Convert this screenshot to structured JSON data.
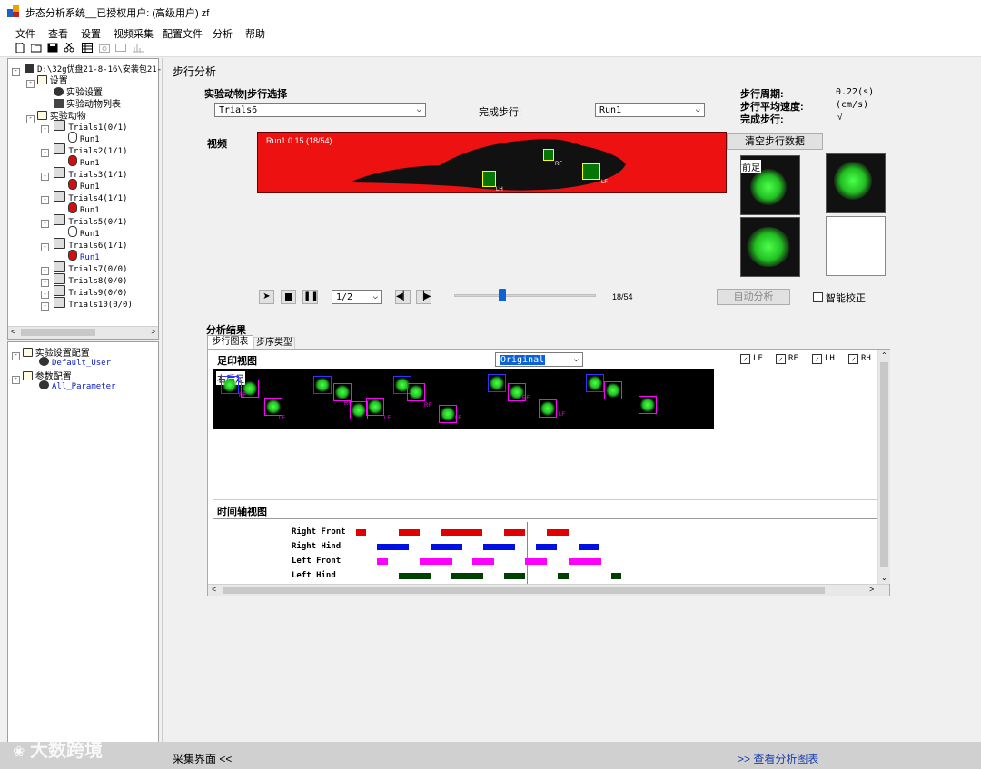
{
  "window": {
    "title": "步态分析系统__已授权用户: (高级用户)  zf"
  },
  "menu": [
    "文件",
    "查看",
    "设置",
    "视频采集",
    "配置文件",
    "分析",
    "帮助"
  ],
  "tree": {
    "root": "D:\\32g优盘21-8-16\\安装包21-",
    "settings": "设置",
    "exp_settings": "实验设置",
    "animal_list": "实验动物列表",
    "animals": "实验动物",
    "trials": [
      {
        "label": "Trials1(0/1)",
        "run": "Run1"
      },
      {
        "label": "Trials2(1/1)",
        "run": "Run1"
      },
      {
        "label": "Trials3(1/1)",
        "run": "Run1"
      },
      {
        "label": "Trials4(1/1)",
        "run": "Run1"
      },
      {
        "label": "Trials5(0/1)",
        "run": "Run1"
      },
      {
        "label": "Trials6(1/1)",
        "run": "Run1"
      },
      {
        "label": "Trials7(0/0)"
      },
      {
        "label": "Trials8(0/0)"
      },
      {
        "label": "Trials9(0/0)"
      },
      {
        "label": "Trials10(0/0)"
      }
    ]
  },
  "config_tree": {
    "exp_config": "实验设置配置",
    "default_user": "Default_User",
    "param_config": "参数配置",
    "all_param": "All_Parameter"
  },
  "main": {
    "section_title": "步行分析",
    "animal_select_label": "实验动物|步行选择",
    "trial_select_value": "Trials6",
    "complete_step_label": "完成步行:",
    "run_select_value": "Run1",
    "stats": {
      "period_label": "步行周期:",
      "period_value": "0.22(s)",
      "speed_label": "步行平均速度:",
      "speed_value": "(cm/s)",
      "complete_label": "完成步行:",
      "complete_value": "√"
    },
    "video_label": "视频",
    "video_overlay": "Run1  0.15  (18/54)",
    "video_tags": [
      "RF",
      "LH",
      "LF"
    ],
    "clear_button": "清空步行数据",
    "thumb_label": "右前足",
    "speed_select": "1/2",
    "frame_counter": "18/54",
    "frame_progress": 0.33,
    "auto_analyze_button": "自动分析",
    "smart_correct_label": "智能校正"
  },
  "results": {
    "section_title": "分析结果",
    "tabs": [
      "步行图表",
      "步序类型"
    ],
    "footprint_view_label": "足印视图",
    "footprint_select": "Original",
    "checkboxes": [
      "LF",
      "RF",
      "LH",
      "RH"
    ],
    "footprint_overlay": "右后足",
    "footprint_tags": [
      "RF",
      "LF",
      "RF",
      "LF",
      "RF",
      "LF",
      "RF",
      "LF"
    ],
    "timeline_label": "时间轴视图",
    "timeline_rows": [
      {
        "name": "Right Front",
        "color": "#e00000"
      },
      {
        "name": "Right Hind",
        "color": "#0010e0"
      },
      {
        "name": "Left Front",
        "color": "#ff00ff"
      },
      {
        "name": "Left Hind",
        "color": "#004000"
      }
    ]
  },
  "bottom": {
    "left": "采集界面 <<",
    "right": ">> 查看分析图表",
    "watermark": "大数跨境"
  }
}
